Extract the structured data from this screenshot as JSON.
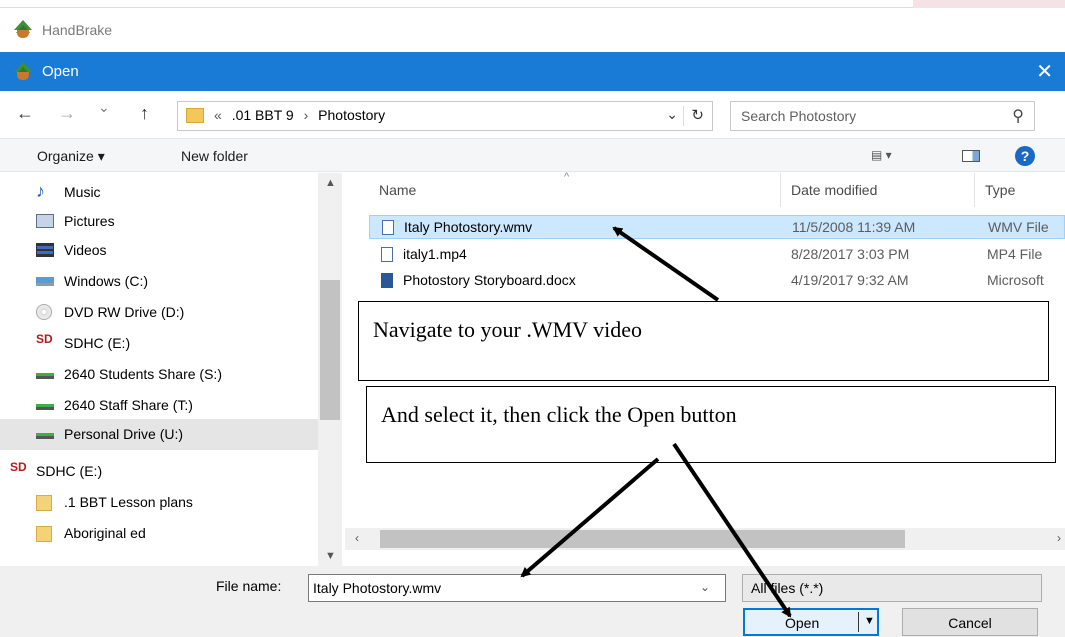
{
  "app": {
    "title": "HandBrake"
  },
  "dialog": {
    "title": "Open",
    "close_glyph": "✕"
  },
  "nav": {
    "back": "←",
    "forward": "→",
    "recent": "⌄",
    "up": "↑",
    "breadcrumb_overflow": "«",
    "breadcrumbs": [
      ".01 BBT 9",
      "Photostory"
    ],
    "separator": "›",
    "dropdown": "⌄",
    "refresh": "↻"
  },
  "search": {
    "placeholder": "Search Photostory",
    "icon": "⚲"
  },
  "toolbar": {
    "organize": "Organize ▾",
    "new_folder": "New folder",
    "view_dd": "▾"
  },
  "sidebar": {
    "items": [
      {
        "label": "Music",
        "icon": "music-icon"
      },
      {
        "label": "Pictures",
        "icon": "pictures-icon"
      },
      {
        "label": "Videos",
        "icon": "videos-icon"
      },
      {
        "label": "Windows (C:)",
        "icon": "drive-icon"
      },
      {
        "label": "DVD RW Drive (D:)",
        "icon": "dvd-icon"
      },
      {
        "label": "SDHC (E:)",
        "icon": "sd-card-icon"
      },
      {
        "label": "2640 Students Share (S:)",
        "icon": "network-drive-icon"
      },
      {
        "label": "2640 Staff Share (T:)",
        "icon": "network-drive-icon"
      },
      {
        "label": "Personal Drive (U:)",
        "icon": "network-drive-icon",
        "selected": true
      },
      {
        "label": "SDHC (E:)",
        "icon": "sd-card-icon"
      },
      {
        "label": ".1 BBT Lesson plans",
        "icon": "folder-icon"
      },
      {
        "label": "Aboriginal ed",
        "icon": "folder-icon"
      }
    ],
    "sd_glyph": "SD"
  },
  "files": {
    "columns": [
      "Name",
      "Date modified",
      "Type"
    ],
    "rows": [
      {
        "name": "Italy Photostory.wmv",
        "date": "11/5/2008 11:39 AM",
        "type": "WMV File",
        "selected": true
      },
      {
        "name": "italy1.mp4",
        "date": "8/28/2017 3:03 PM",
        "type": "MP4 File"
      },
      {
        "name": "Photostory Storyboard.docx",
        "date": "4/19/2017 9:32 AM",
        "type": "Microsoft"
      }
    ]
  },
  "bottom": {
    "file_name_label": "File name:",
    "file_name_value": "Italy Photostory.wmv",
    "file_type": "All files (*.*)",
    "open_label": "Open",
    "cancel_label": "Cancel"
  },
  "callouts": [
    "Navigate to your .WMV video",
    "And select it, then click the Open button"
  ]
}
